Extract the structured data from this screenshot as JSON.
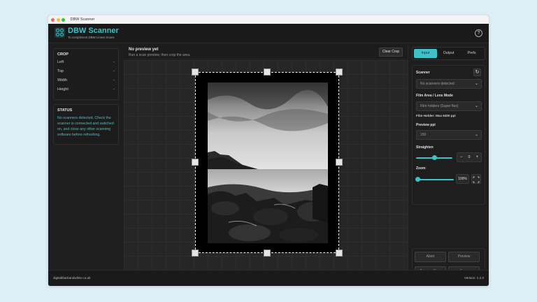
{
  "window": {
    "title": "DBW Scanner",
    "traffic_lights": [
      "#ff5f57",
      "#febc2e",
      "#28c840"
    ]
  },
  "header": {
    "brand": "DBW Scanner",
    "tagline": "To compliment DBW Linear Scans",
    "help_icon": "help-circle-icon"
  },
  "crop": {
    "title": "CROP",
    "fields": [
      {
        "label": "Left",
        "value": "-"
      },
      {
        "label": "Top",
        "value": "-"
      },
      {
        "label": "Width",
        "value": "-"
      },
      {
        "label": "Height",
        "value": "-"
      }
    ]
  },
  "status": {
    "title": "STATUS",
    "message": "No scanners detected. Check the scanner is connected and switched on, and close any other scanning software before refreshing."
  },
  "preview": {
    "title": "No preview yet",
    "hint": "Run a scan preview, then crop the area.",
    "clear_crop": "Clear Crop"
  },
  "tabs": [
    {
      "label": "Input",
      "active": true
    },
    {
      "label": "Output",
      "active": false
    },
    {
      "label": "Prefs",
      "active": false
    }
  ],
  "scanner": {
    "label": "Scanner",
    "refresh_icon": "refresh-icon",
    "selected": "No scanners detected",
    "film_area_label": "Film Area / Lens Mode",
    "film_area_selected": "Film holders (Super flex)",
    "film_holder_note": "Film Holder: Max 6400 ppi",
    "ppi_label": "Preview ppi",
    "ppi_selected": "150",
    "straighten_label": "Straighten",
    "straighten_value": "0",
    "straighten_fraction": 0.5,
    "zoom_label": "Zoom",
    "zoom_value": "100%",
    "zoom_fraction": 1.0
  },
  "actions": {
    "abort": "Abort",
    "preview": "Preview",
    "preview_crop": "Preview Crop",
    "scan": "Scan"
  },
  "footer": {
    "site": "digitalblackandwhite.co.uk",
    "version": "Version: 1.2.0"
  },
  "colors": {
    "accent": "#3fc2c7",
    "background": "#1c1c1c"
  }
}
